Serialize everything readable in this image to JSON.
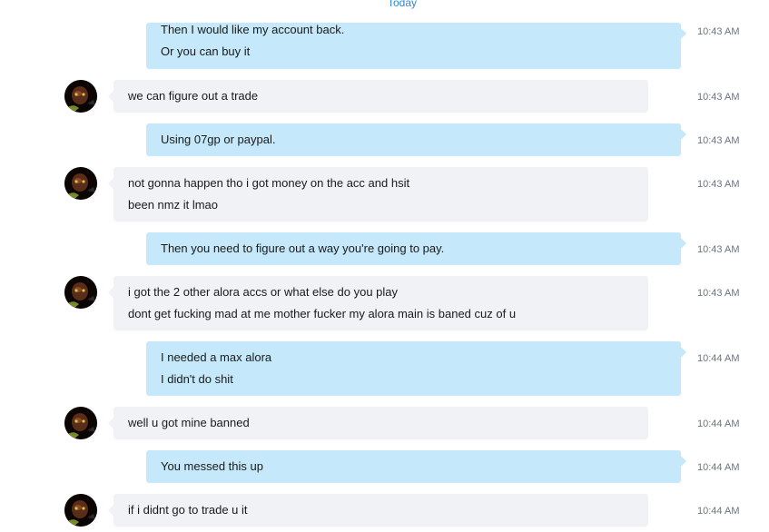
{
  "conversation": {
    "day_separator": "Today",
    "messages": [
      {
        "direction": "out",
        "lines": [
          "Then I would like my account back.",
          "Or you can buy it"
        ],
        "time": "10:43 AM"
      },
      {
        "direction": "in",
        "lines": [
          "we can figure out a trade"
        ],
        "time": "10:43 AM",
        "avatar": "contact-avatar"
      },
      {
        "direction": "out",
        "lines": [
          "Using 07gp or paypal."
        ],
        "time": "10:43 AM"
      },
      {
        "direction": "in",
        "lines": [
          "not gonna happen tho i got money on the acc and hsit",
          "been nmz it lmao"
        ],
        "time": "10:43 AM",
        "avatar": "contact-avatar"
      },
      {
        "direction": "out",
        "lines": [
          "Then you need to figure out a way you're going to pay."
        ],
        "time": "10:43 AM"
      },
      {
        "direction": "in",
        "lines": [
          "i got the 2 other alora accs or what else do you play",
          "dont get fucking mad at me mother fucker my alora main is baned cuz of u"
        ],
        "time": "10:43 AM",
        "avatar": "contact-avatar"
      },
      {
        "direction": "out",
        "lines": [
          "I needed a max alora",
          "I didn't do shit"
        ],
        "time": "10:44 AM"
      },
      {
        "direction": "in",
        "lines": [
          "well u got mine banned"
        ],
        "time": "10:44 AM",
        "avatar": "contact-avatar"
      },
      {
        "direction": "out",
        "lines": [
          "You messed this up"
        ],
        "time": "10:44 AM"
      },
      {
        "direction": "in",
        "lines": [
          "if i didnt go to trade u it"
        ],
        "time": "10:44 AM",
        "avatar": "contact-avatar"
      }
    ]
  },
  "colors": {
    "incoming_bubble": "#f0f2f5",
    "outgoing_bubble": "#c5e9fa",
    "day_separator": "#2f8ad8",
    "timestamp": "#6b7480"
  }
}
